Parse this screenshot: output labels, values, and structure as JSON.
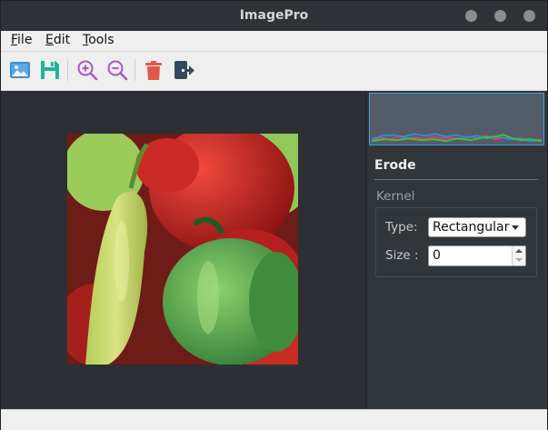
{
  "window": {
    "title": "ImagePro"
  },
  "menubar": {
    "items": [
      {
        "mnemonic": "F",
        "rest": "ile"
      },
      {
        "mnemonic": "E",
        "rest": "dit"
      },
      {
        "mnemonic": "T",
        "rest": "ools"
      }
    ]
  },
  "toolbar": {
    "tools": [
      "open-image-icon",
      "save-icon",
      "zoom-in-icon",
      "zoom-out-icon",
      "delete-icon",
      "exit-icon"
    ]
  },
  "colors": {
    "accent_blue": "#3d8fd1",
    "save_green": "#25b19a",
    "zoom_purple": "#a659c6",
    "delete_red": "#e2574c",
    "exit_dark": "#34495e"
  },
  "panel": {
    "operation_title": "Erode",
    "group_title": "Kernel",
    "type_label": "Type:",
    "type_value": "Rectangular",
    "size_label": "Size :",
    "size_value": "0"
  }
}
